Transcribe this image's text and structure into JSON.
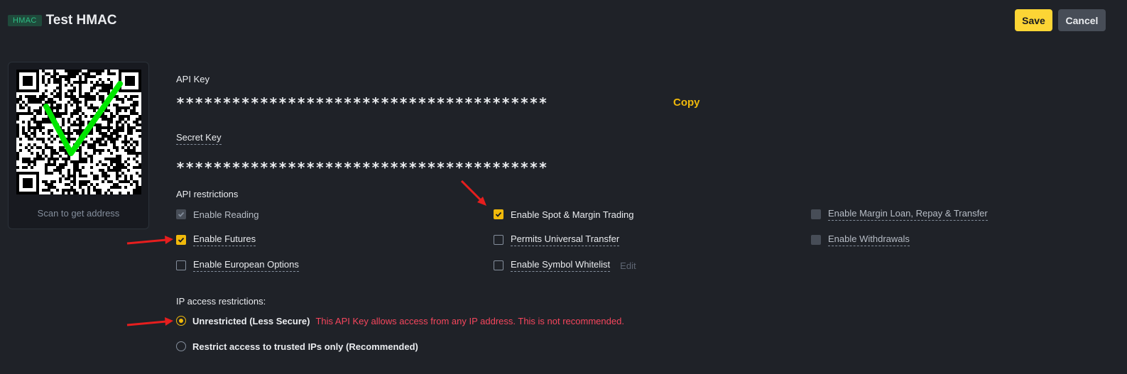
{
  "header": {
    "badge": "HMAC",
    "title": "Test HMAC"
  },
  "buttons": {
    "save": "Save",
    "cancel": "Cancel"
  },
  "qr": {
    "caption": "Scan to get address"
  },
  "api_key": {
    "label": "API Key",
    "value": "****************************************",
    "copy": "Copy"
  },
  "secret_key": {
    "label": "Secret Key",
    "value": "****************************************"
  },
  "restrictions": {
    "title": "API restrictions",
    "options": [
      {
        "label": "Enable Reading",
        "state": "checked-disabled"
      },
      {
        "label": "Enable Spot & Margin Trading",
        "state": "checked"
      },
      {
        "label": "Enable Margin Loan, Repay & Transfer",
        "state": "disabled"
      },
      {
        "label": "Enable Futures",
        "state": "checked"
      },
      {
        "label": "Permits Universal Transfer",
        "state": "unchecked"
      },
      {
        "label": "Enable Withdrawals",
        "state": "disabled"
      },
      {
        "label": "Enable European Options",
        "state": "unchecked"
      },
      {
        "label": "Enable Symbol Whitelist",
        "state": "unchecked"
      }
    ],
    "edit": "Edit"
  },
  "ip": {
    "title": "IP access restrictions:",
    "unrestricted": "Unrestricted (Less Secure)",
    "warning": "This API Key allows access from any IP address. This is not recommended.",
    "restricted": "Restrict access to trusted IPs only (Recommended)"
  },
  "colors": {
    "accent": "#f0b90b",
    "warning": "#f6465d",
    "background": "#1f2228",
    "annotation_red": "#e61e1e",
    "annotation_green": "#00e600"
  }
}
